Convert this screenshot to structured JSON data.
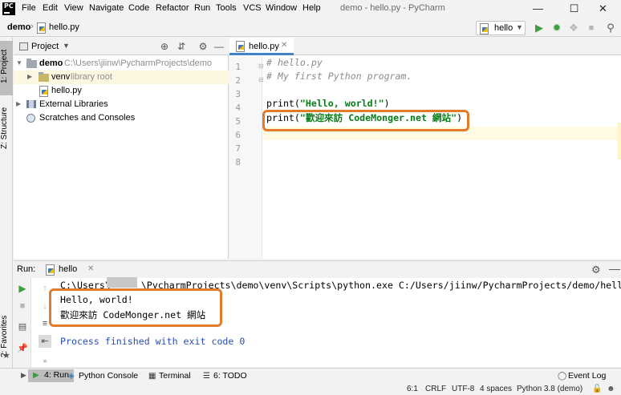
{
  "menu": {
    "items": [
      "File",
      "Edit",
      "View",
      "Navigate",
      "Code",
      "Refactor",
      "Run",
      "Tools",
      "VCS",
      "Window",
      "Help"
    ],
    "window_title": "demo - hello.py - PyCharm",
    "logo": "PC"
  },
  "navbar": {
    "crumbs": [
      "demo",
      "hello.py"
    ],
    "run_config": "hello"
  },
  "left_tabs": {
    "project": "1: Project",
    "structure": "Z: Structure",
    "favorites": "2: Favorites"
  },
  "project": {
    "title": "Project",
    "tree": [
      {
        "name": "demo",
        "path": "C:\\Users\\jiinw\\PycharmProjects\\demo"
      },
      {
        "name": "venv",
        "note": "library root"
      },
      {
        "name": "hello.py"
      },
      {
        "name": "External Libraries"
      },
      {
        "name": "Scratches and Consoles"
      }
    ]
  },
  "editor": {
    "tab": "hello.py",
    "line_numbers": [
      "1",
      "2",
      "3",
      "4",
      "5",
      "6",
      "7",
      "8"
    ],
    "lines": {
      "l1": "# hello.py",
      "l2": "# My first Python program.",
      "l4_fn": "print(",
      "l4_str": "\"Hello, world!\"",
      "l4_end": ")",
      "l5_fn": "print(",
      "l5_str": "\"歡迎來訪 CodeMonger.net 網站\"",
      "l5_end": ")"
    }
  },
  "run": {
    "label": "Run:",
    "tab": "hello",
    "cmd_part1": "C:\\Users\\",
    "cmd_part2": "\\PycharmProjects\\demo\\venv\\Scripts\\python.exe C:/Users/jiinw/PycharmProjects/demo/hello.py",
    "out1": "Hello, world!",
    "out2": "歡迎來訪 CodeMonger.net 網站",
    "finish": "Process finished with exit code 0"
  },
  "bottom_tabs": {
    "run": "4: Run",
    "python_console": "Python Console",
    "terminal": "Terminal",
    "todo": "6: TODO",
    "event_log": "Event Log"
  },
  "status": {
    "position": "6:1",
    "line_sep": "CRLF",
    "encoding": "UTF-8",
    "indent": "4 spaces",
    "interpreter": "Python 3.8 (demo)"
  },
  "colors": {
    "highlight_box": "#e07c2c",
    "string": "#067d17",
    "comment": "#8c8c8c",
    "console_blue": "#2a4fb0",
    "run_green": "#3c9e3c"
  }
}
